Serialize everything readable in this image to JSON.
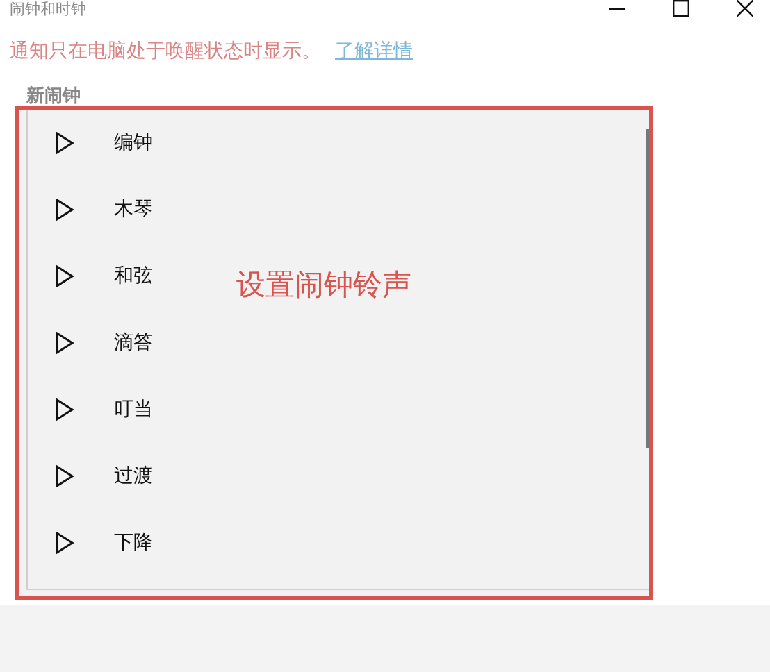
{
  "window": {
    "title": "闹钟和时钟"
  },
  "notice": {
    "text": "通知只在电脑处于唤醒状态时显示。",
    "link": "了解详情"
  },
  "section_label": "新闹钟",
  "sounds": [
    {
      "label": "编钟"
    },
    {
      "label": "木琴"
    },
    {
      "label": "和弦"
    },
    {
      "label": "滴答"
    },
    {
      "label": "叮当"
    },
    {
      "label": "过渡"
    },
    {
      "label": "下降"
    }
  ],
  "annotation": "设置闹钟铃声"
}
